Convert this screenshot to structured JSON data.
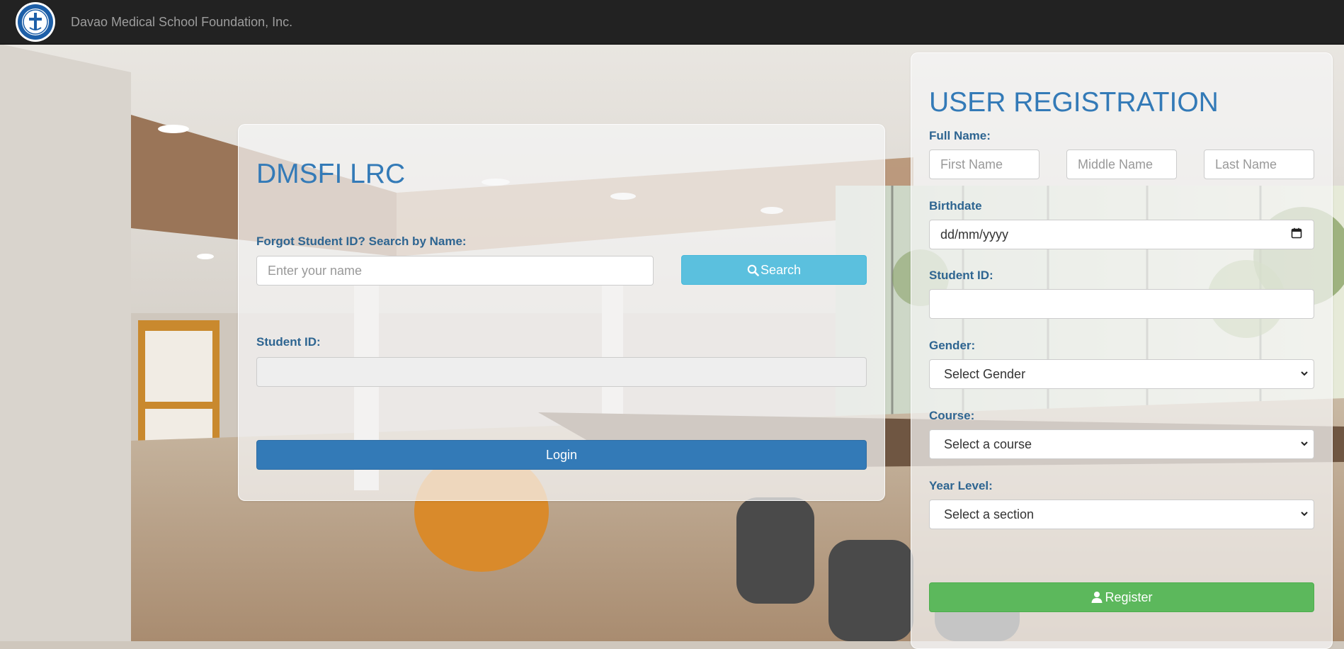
{
  "navbar": {
    "brand": "Davao Medical School Foundation, Inc.",
    "logo_icon": "school-seal-logo"
  },
  "login": {
    "title": "DMSFI LRC",
    "search_label": "Forgot Student ID? Search by Name:",
    "search_placeholder": "Enter your name",
    "search_button": "Search",
    "search_icon": "search-icon",
    "student_id_label": "Student ID:",
    "student_id_value": "",
    "login_button": "Login"
  },
  "registration": {
    "title": "USER REGISTRATION",
    "full_name_label": "Full Name:",
    "first_name_placeholder": "First Name",
    "middle_name_placeholder": "Middle Name",
    "last_name_placeholder": "Last Name",
    "birthdate_label": "Birthdate",
    "birthdate_placeholder": "dd/mm/yyyy",
    "calendar_icon": "calendar-icon",
    "student_id_label": "Student ID:",
    "student_id_value": "",
    "gender_label": "Gender:",
    "gender_selected": "Select Gender",
    "course_label": "Course:",
    "course_selected": "Select a course",
    "year_level_label": "Year Level:",
    "year_level_selected": "Select a section",
    "register_button": "Register",
    "register_icon": "user-icon"
  },
  "colors": {
    "navbar_bg": "#222222",
    "heading": "#337ab7",
    "label": "#2e6591",
    "search_button": "#5bc0de",
    "login_button": "#337ab7",
    "register_button": "#5cb85c"
  }
}
